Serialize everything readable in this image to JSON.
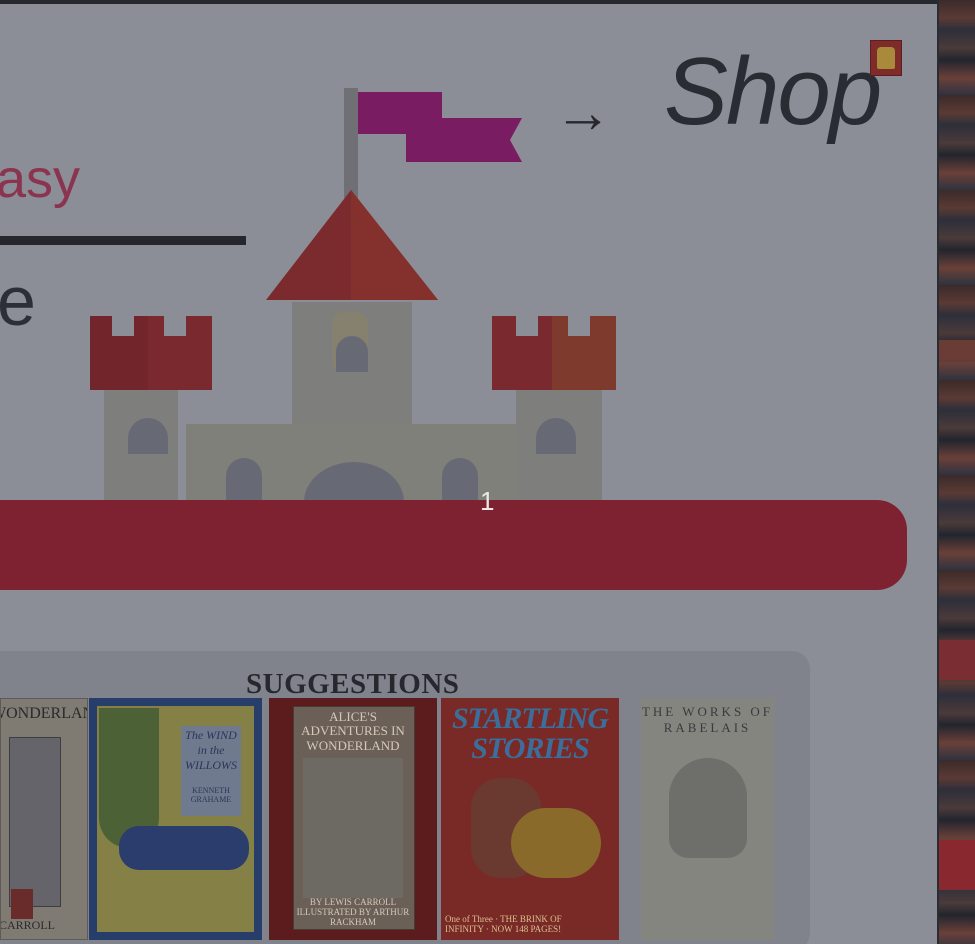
{
  "hero": {
    "word_top": "asy",
    "word_bottom": "e",
    "arrow": "→",
    "title": "Shop"
  },
  "page_indicator": "1",
  "suggestions": {
    "title": "SUGGESTIONS",
    "books": [
      {
        "title": "WONDERLAND",
        "author": "CARROLL"
      },
      {
        "title": "The WIND in the WILLOWS",
        "author": "KENNETH GRAHAME"
      },
      {
        "title": "ALICE'S ADVENTURES IN WONDERLAND",
        "author": "BY LEWIS CARROLL ILLUSTRATED BY ARTHUR RACKHAM"
      },
      {
        "title": "STARTLING STORIES",
        "author": "One of Three · THE BRINK OF INFINITY · NOW 148 PAGES!"
      },
      {
        "title": "THE WORKS OF RABELAIS",
        "author": ""
      }
    ]
  },
  "colors": {
    "banner": "#7e2232",
    "flag": "#7a1c62",
    "roof": "#7b2a2e"
  },
  "icons": [
    "shop-logo-icon",
    "castle-illustration"
  ]
}
